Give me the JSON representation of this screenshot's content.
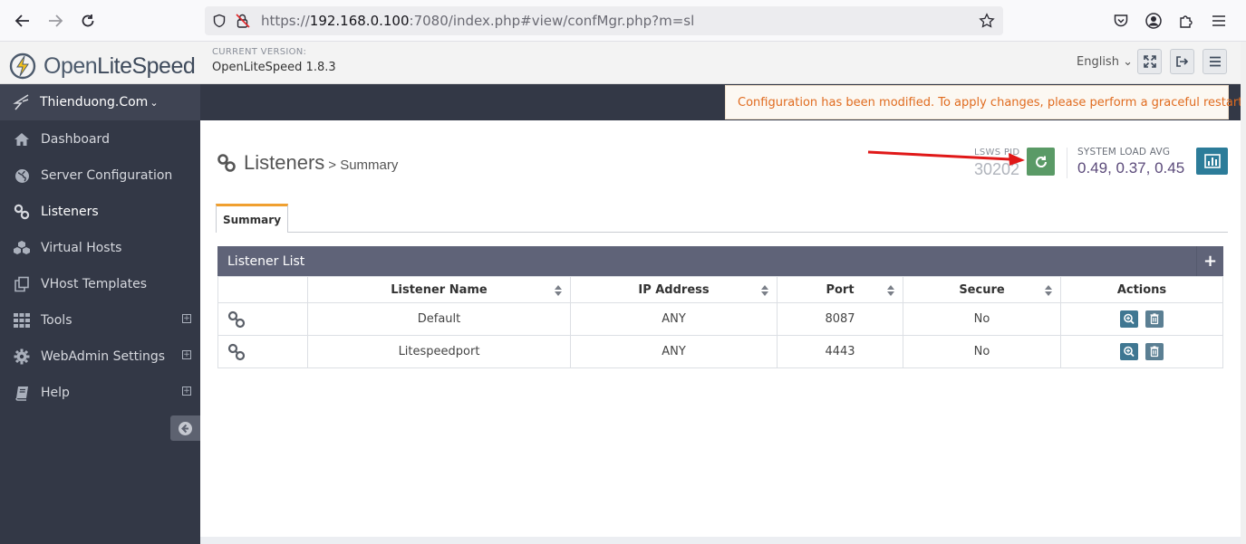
{
  "browser": {
    "url_prefix": "https://",
    "url_host": "192.168.0.100",
    "url_rest": ":7080/index.php#view/confMgr.php?m=sl"
  },
  "header": {
    "logo_text_a": "Open",
    "logo_text_b": "LiteSpeed",
    "version_label": "CURRENT VERSION:",
    "version_value": "OpenLiteSpeed 1.8.3",
    "language": "English"
  },
  "sidebar": {
    "site_name": "Thienduong.Com",
    "items": [
      {
        "label": "Dashboard",
        "icon": "home-icon"
      },
      {
        "label": "Server Configuration",
        "icon": "globe-icon"
      },
      {
        "label": "Listeners",
        "icon": "link-icon"
      },
      {
        "label": "Virtual Hosts",
        "icon": "cubes-icon"
      },
      {
        "label": "VHost Templates",
        "icon": "copy-icon"
      },
      {
        "label": "Tools",
        "icon": "grid-icon",
        "expandable": true
      },
      {
        "label": "WebAdmin Settings",
        "icon": "gear-icon",
        "expandable": true
      },
      {
        "label": "Help",
        "icon": "book-icon",
        "expandable": true
      }
    ]
  },
  "notice": {
    "text": "Configuration has been modified. To apply changes, please perform a graceful restart.",
    "color": "#e06b1f"
  },
  "main": {
    "title": "Listeners",
    "subtitle": "> Summary",
    "pid_label": "LSWS PID",
    "pid_value": "30202",
    "load_label": "SYSTEM LOAD AVG",
    "load_value": "0.49, 0.37, 0.45",
    "tab_label": "Summary",
    "panel_title": "Listener List",
    "columns": [
      "Listener Name",
      "IP Address",
      "Port",
      "Secure",
      "Actions"
    ],
    "rows": [
      {
        "name": "Default",
        "ip": "ANY",
        "port": "8087",
        "secure": "No"
      },
      {
        "name": "Litespeedport",
        "ip": "ANY",
        "port": "4443",
        "secure": "No"
      }
    ]
  },
  "colors": {
    "sidebar_bg": "#333846",
    "panel_head": "#5f6378",
    "restart_btn": "#5a9a66",
    "chart_btn": "#2c7c99",
    "tab_accent": "#f0a030"
  }
}
